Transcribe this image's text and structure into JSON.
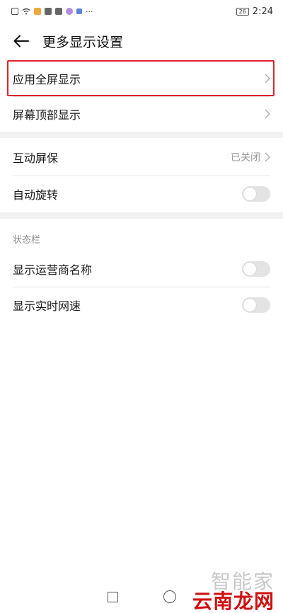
{
  "status_bar": {
    "battery": "26",
    "time": "2:24",
    "icons": [
      "alert-icon",
      "wifi-icon",
      "app-icon-orange",
      "app-icon-photo",
      "app-icon-square",
      "app-icon-purple",
      "app-icon-arrow",
      "more-dots-icon"
    ]
  },
  "header": {
    "title": "更多显示设置",
    "back_icon": "back-arrow-icon"
  },
  "group1": {
    "item1": "应用全屏显示",
    "item2": "屏幕顶部显示"
  },
  "group2": {
    "item1": "互动屏保",
    "item1_value": "已关闭",
    "item2": "自动旋转",
    "item2_toggle_on": false
  },
  "status_section": {
    "label": "状态栏",
    "item1": "显示运营商名称",
    "item1_toggle_on": false,
    "item2": "显示实时网速",
    "item2_toggle_on": false
  },
  "colors": {
    "highlight_border": "#e0222c",
    "separator_band": "#f1f1f1",
    "toggle_off": "#e3e3e3"
  },
  "watermark": {
    "logo": "智能家",
    "site": "云南龙网"
  }
}
